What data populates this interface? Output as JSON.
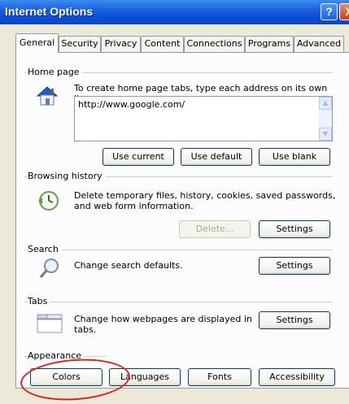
{
  "window": {
    "title": "Internet Options",
    "help_label": "?",
    "close_label": "X"
  },
  "tabs": [
    {
      "label": "General",
      "active": true
    },
    {
      "label": "Security"
    },
    {
      "label": "Privacy"
    },
    {
      "label": "Content"
    },
    {
      "label": "Connections"
    },
    {
      "label": "Programs"
    },
    {
      "label": "Advanced"
    }
  ],
  "home_page": {
    "group_label": "Home page",
    "description": "To create home page tabs, type each address on its own line.",
    "address_value": "http://www.google.com/",
    "use_current": "Use current",
    "use_default": "Use default",
    "use_blank": "Use blank",
    "icon": "house-icon"
  },
  "browsing_history": {
    "group_label": "Browsing history",
    "description_line1": "Delete temporary files, history, cookies, saved passwords,",
    "description_line2": "and web form information.",
    "delete_label": "Delete...",
    "settings_label": "Settings",
    "icon": "history-clock-icon"
  },
  "search": {
    "group_label": "Search",
    "description": "Change search defaults.",
    "settings_label": "Settings",
    "icon": "magnifier-icon"
  },
  "tabs_group": {
    "group_label": "Tabs",
    "description_line1": "Change how webpages are displayed in",
    "description_line2": "tabs.",
    "settings_label": "Settings",
    "icon": "tabs-window-icon"
  },
  "appearance": {
    "group_label": "Appearance",
    "colors": "Colors",
    "languages": "Languages",
    "fonts": "Fonts",
    "accessibility": "Accessibility"
  },
  "colors": {
    "title_bar": "#0b4fd6",
    "annotation_circle": "#e0201a"
  }
}
